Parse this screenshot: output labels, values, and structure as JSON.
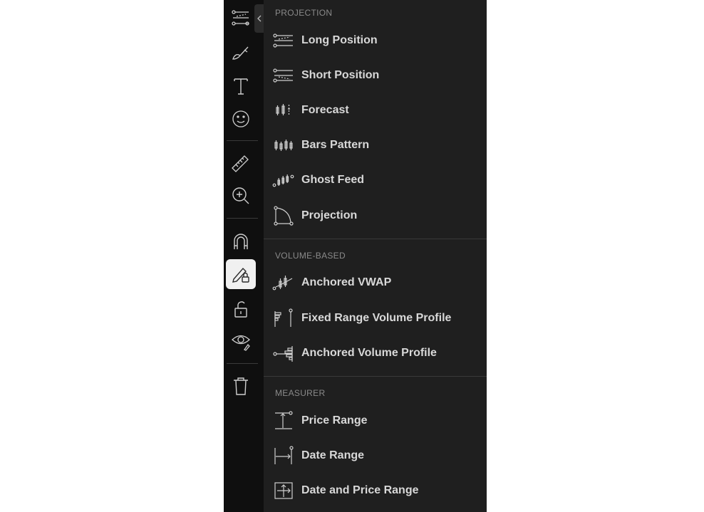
{
  "toolbar": {
    "tools": [
      {
        "icon": "trend-lines-icon",
        "active": false
      },
      {
        "icon": "brush-icon",
        "active": false
      },
      {
        "icon": "text-icon",
        "active": false
      },
      {
        "icon": "emoji-icon",
        "active": false
      },
      {
        "icon": "ruler-icon",
        "active": false
      },
      {
        "icon": "zoom-in-icon",
        "active": false
      },
      {
        "icon": "magnet-icon",
        "active": false
      },
      {
        "icon": "stay-in-drawing-mode-icon",
        "active": true
      },
      {
        "icon": "lock-icon",
        "active": false
      },
      {
        "icon": "hide-drawings-icon",
        "active": false
      },
      {
        "icon": "trash-icon",
        "active": false
      }
    ]
  },
  "panel": {
    "sections": [
      {
        "header": "PROJECTION",
        "items": [
          {
            "label": "Long Position",
            "icon": "long-position-icon"
          },
          {
            "label": "Short Position",
            "icon": "short-position-icon"
          },
          {
            "label": "Forecast",
            "icon": "forecast-icon"
          },
          {
            "label": "Bars Pattern",
            "icon": "bars-pattern-icon"
          },
          {
            "label": "Ghost Feed",
            "icon": "ghost-feed-icon"
          },
          {
            "label": "Projection",
            "icon": "projection-icon"
          }
        ]
      },
      {
        "header": "VOLUME-BASED",
        "items": [
          {
            "label": "Anchored VWAP",
            "icon": "anchored-vwap-icon"
          },
          {
            "label": "Fixed Range Volume Profile",
            "icon": "fixed-range-volume-profile-icon"
          },
          {
            "label": "Anchored Volume Profile",
            "icon": "anchored-volume-profile-icon"
          }
        ]
      },
      {
        "header": "MEASURER",
        "items": [
          {
            "label": "Price Range",
            "icon": "price-range-icon"
          },
          {
            "label": "Date Range",
            "icon": "date-range-icon"
          },
          {
            "label": "Date and Price Range",
            "icon": "date-and-price-range-icon"
          }
        ]
      }
    ]
  },
  "colors": {
    "toolbar_bg": "#0f0f0f",
    "panel_bg": "#1f1f1f",
    "active_tool_bg": "#f0f0f0",
    "text": "#d8d8d8",
    "header_text": "#8a8a8a"
  }
}
